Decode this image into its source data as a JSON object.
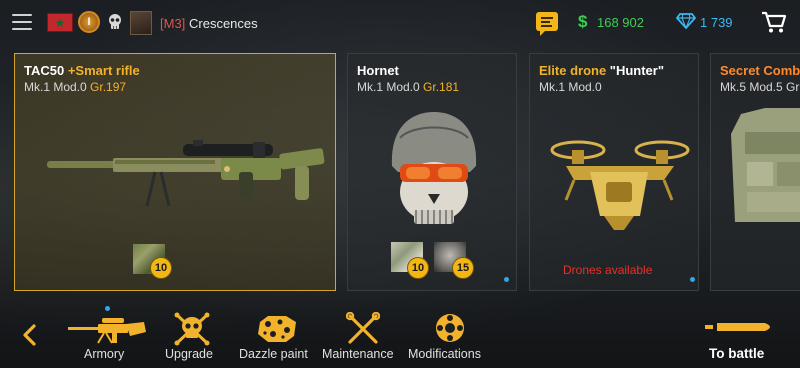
{
  "header": {
    "player_tag": "[M3]",
    "player_name": "Crescences",
    "rank_letter": "I",
    "money": "168 902",
    "gems": "1 739"
  },
  "cards": [
    {
      "title_main": "TAC50 ",
      "title_highlight": "+Smart rifle",
      "sub_main": "Mk.1 Mod.0 ",
      "sub_grade": "Gr.197",
      "badges": [
        "10"
      ],
      "selected": true
    },
    {
      "title_main": "Hornet",
      "sub_main": "Mk.1 Mod.0 ",
      "sub_grade": "Gr.181",
      "badges": [
        "10",
        "15"
      ]
    },
    {
      "title_main": "Elite drone ",
      "title_highlight": "\"Hunter\"",
      "sub_main": "Mk.1 Mod.0",
      "note": "Drones available"
    },
    {
      "title_main": "Secret Combat",
      "sub_main": "Mk.5 Mod.5 Gr"
    }
  ],
  "nav": {
    "items": [
      {
        "label": "Armory",
        "icon": "rifle-icon"
      },
      {
        "label": "Upgrade",
        "icon": "skull-crossbones-icon"
      },
      {
        "label": "Dazzle paint",
        "icon": "camo-icon"
      },
      {
        "label": "Maintenance",
        "icon": "wrench-cross-icon"
      },
      {
        "label": "Modifications",
        "icon": "gear-drum-icon"
      }
    ],
    "to_battle": "To battle"
  },
  "colors": {
    "accent": "#f2b22c",
    "money": "#3fce52",
    "gems": "#3eb8f0",
    "alert": "#e5322a",
    "player_tag": "#e05548"
  }
}
